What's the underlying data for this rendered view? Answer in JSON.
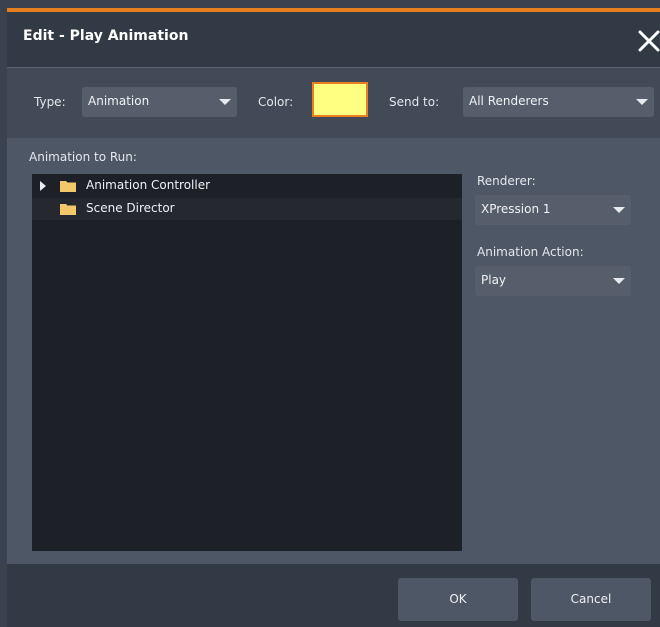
{
  "dialog": {
    "title": "Edit - Play Animation",
    "accent_color": "#e57e1e",
    "close_icon": "close-icon"
  },
  "top_row": {
    "type_label": "Type:",
    "type_value": "Animation",
    "color_label": "Color:",
    "color_value": "#ffff82",
    "send_to_label": "Send to:",
    "send_to_value": "All Renderers"
  },
  "animation_to_run": {
    "label": "Animation to Run:",
    "items": [
      {
        "label": "Animation Controller",
        "expandable": true,
        "icon": "folder-icon"
      },
      {
        "label": "Scene Director",
        "expandable": false,
        "icon": "folder-icon"
      }
    ]
  },
  "renderer": {
    "label": "Renderer:",
    "value": "XPression 1"
  },
  "animation_action": {
    "label": "Animation Action:",
    "value": "Play"
  },
  "footer": {
    "ok_label": "OK",
    "cancel_label": "Cancel"
  }
}
